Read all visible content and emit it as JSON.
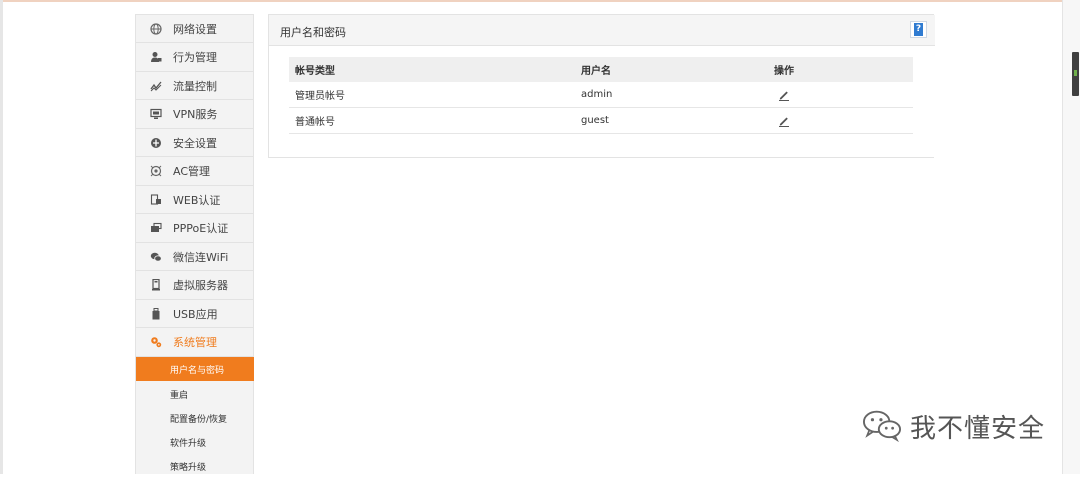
{
  "sidebar": {
    "items": [
      {
        "label": "网络设置",
        "icon": "globe-icon"
      },
      {
        "label": "行为管理",
        "icon": "user-manage-icon"
      },
      {
        "label": "流量控制",
        "icon": "traffic-icon"
      },
      {
        "label": "VPN服务",
        "icon": "vpn-icon"
      },
      {
        "label": "安全设置",
        "icon": "shield-icon"
      },
      {
        "label": "AC管理",
        "icon": "ac-icon"
      },
      {
        "label": "WEB认证",
        "icon": "web-auth-icon"
      },
      {
        "label": "PPPoE认证",
        "icon": "pppoe-icon"
      },
      {
        "label": "微信连WiFi",
        "icon": "wechat-icon"
      },
      {
        "label": "虚拟服务器",
        "icon": "server-icon"
      },
      {
        "label": "USB应用",
        "icon": "usb-icon"
      },
      {
        "label": "系统管理",
        "icon": "gear-icon"
      }
    ],
    "subitems": [
      {
        "label": "用户名与密码",
        "active": true
      },
      {
        "label": "重启",
        "active": false
      },
      {
        "label": "配置备份/恢复",
        "active": false
      },
      {
        "label": "软件升级",
        "active": false
      },
      {
        "label": "策略升级",
        "active": false
      }
    ]
  },
  "panel": {
    "title": "用户名和密码",
    "help_icon": "help-icon",
    "help_glyph": "?"
  },
  "table": {
    "headers": [
      "帐号类型",
      "用户名",
      "操作"
    ],
    "rows": [
      {
        "type": "管理员帐号",
        "username": "admin",
        "action_icon": "edit-icon"
      },
      {
        "type": "普通帐号",
        "username": "guest",
        "action_icon": "edit-icon"
      }
    ]
  },
  "watermark": {
    "text": "我不懂安全",
    "icon": "wechat-logo-icon"
  },
  "colors": {
    "accent": "#f07c1e",
    "help_blue": "#2f7bd1"
  }
}
